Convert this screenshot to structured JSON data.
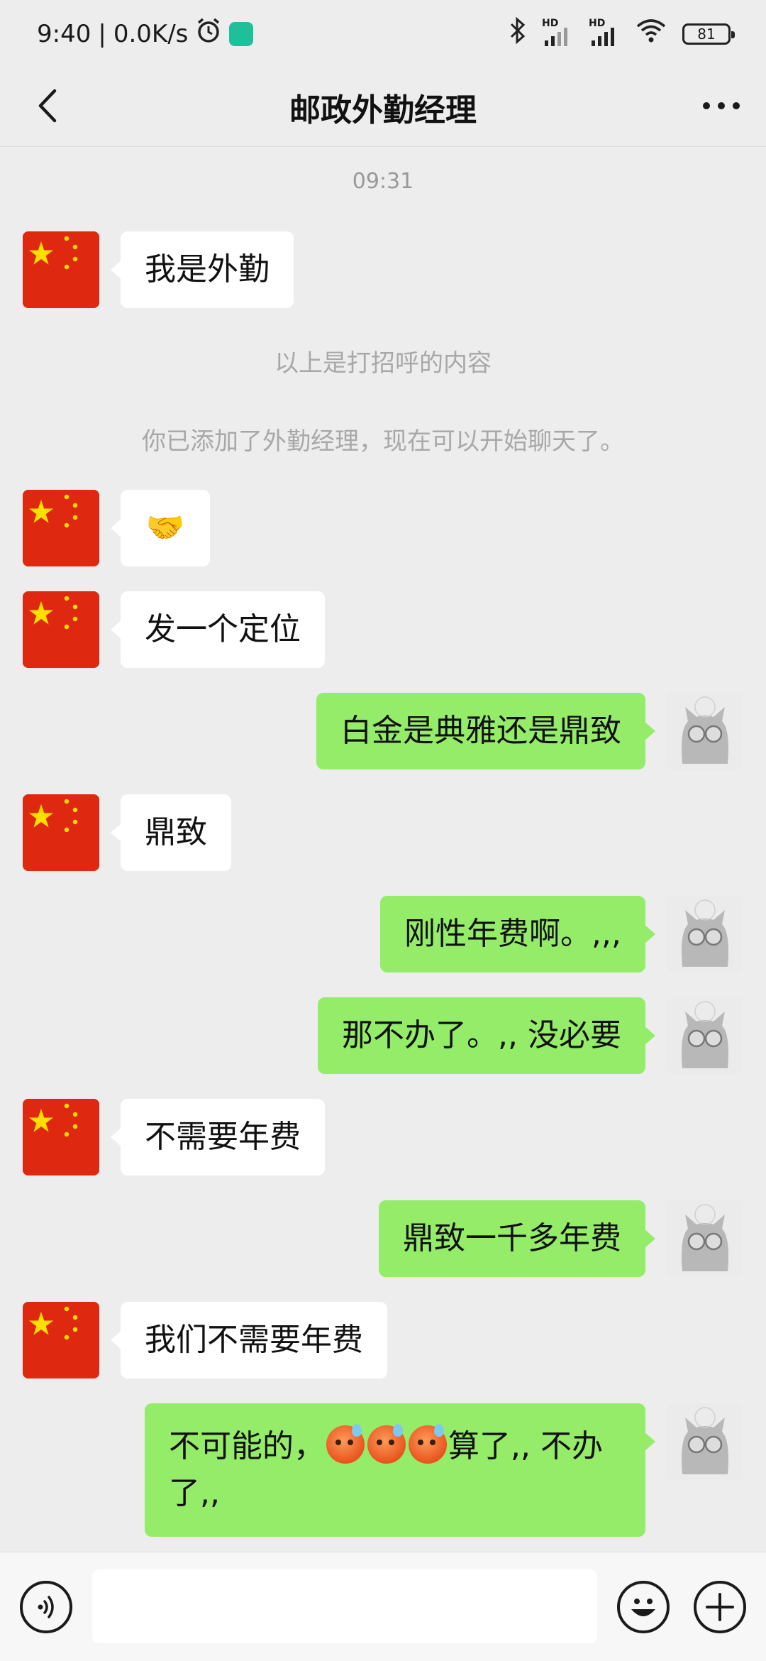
{
  "status_bar": {
    "time": "9:40",
    "separator": "|",
    "net_speed": "0.0K/s",
    "hd1": "HD",
    "hd2": "HD",
    "battery": "81"
  },
  "header": {
    "title": "邮政外勤经理",
    "back_icon": "chevron-left-icon",
    "more_icon": "more-dots-icon"
  },
  "chat": {
    "time_separator": "09:31",
    "system_messages": [
      "以上是打招呼的内容",
      "你已添加了外勤经理，现在可以开始聊天了。"
    ],
    "messages": [
      {
        "side": "in",
        "text": "我是外勤"
      },
      {
        "side": "in",
        "text": "🤝"
      },
      {
        "side": "in",
        "text": "发一个定位"
      },
      {
        "side": "out",
        "text": "白金是典雅还是鼎致"
      },
      {
        "side": "in",
        "text": "鼎致"
      },
      {
        "side": "out",
        "text": "刚性年费啊。,,,"
      },
      {
        "side": "out",
        "text": "那不办了。,, 没必要"
      },
      {
        "side": "in",
        "text": "不需要年费"
      },
      {
        "side": "out",
        "text": "鼎致一千多年费"
      },
      {
        "side": "in",
        "text": "我们不需要年费"
      },
      {
        "side": "out",
        "text_prefix": "不可能的，",
        "emoji": "sweat-face-emoji",
        "text_suffix": "算了,, 不办了,,"
      }
    ]
  },
  "input_bar": {
    "voice_icon": "voice-icon",
    "placeholder": "",
    "emoji_icon": "emoji-icon",
    "plus_icon": "plus-icon"
  },
  "colors": {
    "background": "#ededed",
    "outgoing_bubble": "#95ec69",
    "incoming_bubble": "#ffffff",
    "flag_red": "#de2910",
    "flag_star": "#ffde00"
  }
}
